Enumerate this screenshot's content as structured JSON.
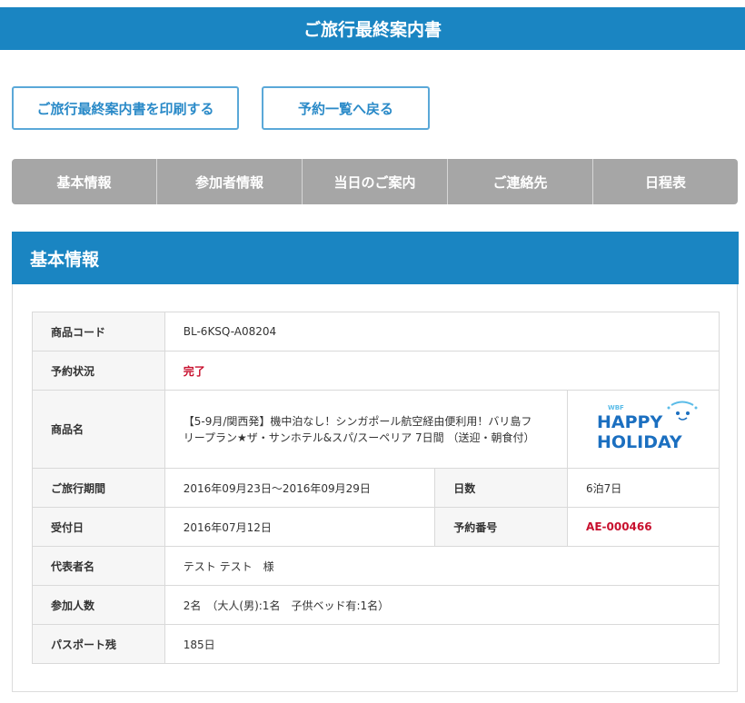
{
  "header": {
    "title": "ご旅行最終案内書"
  },
  "buttons": {
    "print": "ご旅行最終案内書を印刷する",
    "back": "予約一覧へ戻る"
  },
  "tabs": [
    "基本情報",
    "参加者情報",
    "当日のご案内",
    "ご連絡先",
    "日程表"
  ],
  "section": {
    "title": "基本情報"
  },
  "info": {
    "product_code_label": "商品コード",
    "product_code": "BL-6KSQ-A08204",
    "status_label": "予約状況",
    "status": "完了",
    "product_name_label": "商品名",
    "product_name_line1": "【5-9月/関西発】機中泊なし！シンガポール航空経由便利用！バリ島フ",
    "product_name_line2": "リープラン★ザ・サンホテル&スパ/スーペリア 7日間 （送迎・朝食付）",
    "logo": {
      "small": "WBF",
      "line1": "HAPPY",
      "line2": "HOLIDAY",
      "color": "#1b6fc0",
      "accent": "#5bbce8"
    },
    "period_label": "ご旅行期間",
    "period": "2016年09月23日～2016年09月29日",
    "days_label": "日数",
    "days": "6泊7日",
    "accepted_label": "受付日",
    "accepted": "2016年07月12日",
    "booking_no_label": "予約番号",
    "booking_no": "AE-000466",
    "representative_label": "代表者名",
    "representative": "テスト テスト　様",
    "participants_label": "参加人数",
    "participants": "2名　（大人(男):1名　子供ベッド有:1名）",
    "passport_label": "パスポート残",
    "passport": "185日"
  },
  "colors": {
    "primary": "#1a85c2",
    "tab_bg": "#a6a6a6",
    "accent_red": "#c8102e"
  }
}
